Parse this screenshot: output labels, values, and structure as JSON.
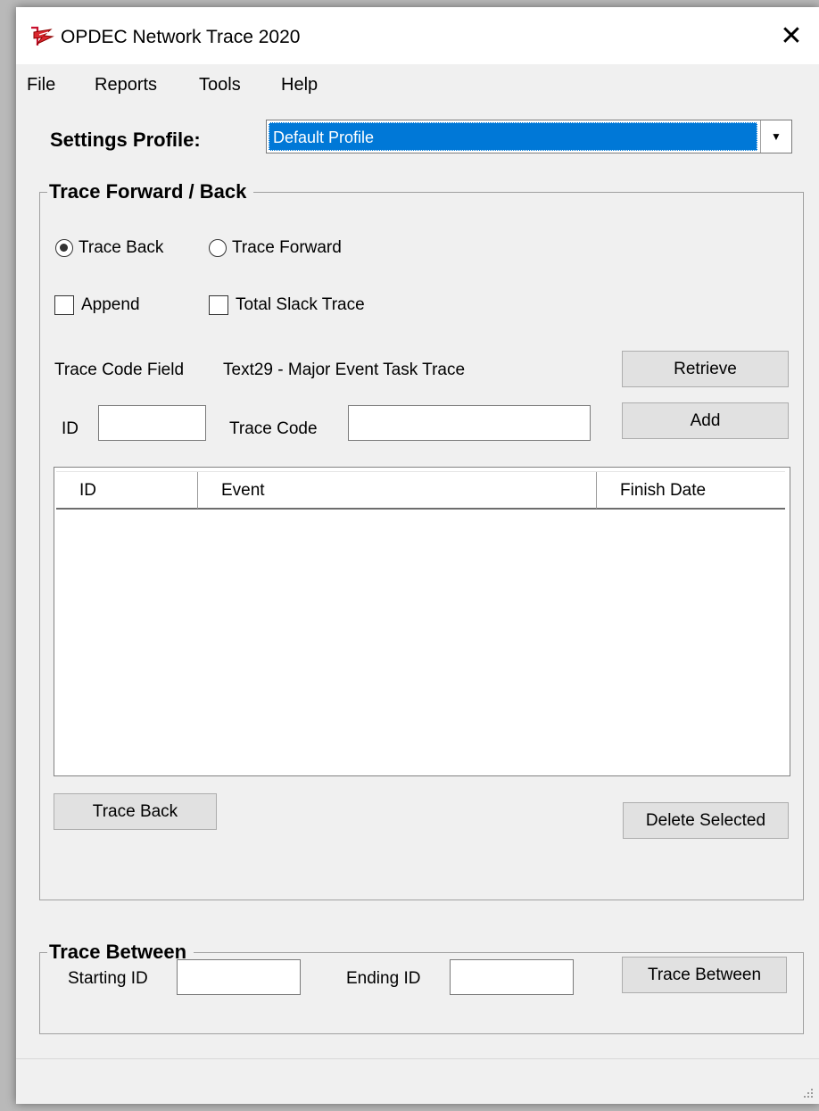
{
  "window": {
    "title": "OPDEC Network Trace 2020"
  },
  "menu": [
    {
      "label": "File"
    },
    {
      "label": "Reports"
    },
    {
      "label": "Tools"
    },
    {
      "label": "Help"
    }
  ],
  "settings": {
    "label": "Settings Profile:",
    "selected": "Default Profile"
  },
  "trace_group": {
    "legend": "Trace Forward / Back",
    "radio_back": "Trace Back",
    "radio_forward": "Trace Forward",
    "selected_radio": "Trace Back",
    "append_label": "Append",
    "append_checked": false,
    "total_slack_label": "Total Slack Trace",
    "total_slack_checked": false,
    "trace_code_field_label": "Trace Code Field",
    "trace_code_field_value": "Text29 - Major Event Task Trace",
    "retrieve_label": "Retrieve",
    "id_label": "ID",
    "id_value": "",
    "trace_code_label": "Trace Code",
    "trace_code_value": "",
    "add_label": "Add",
    "columns": [
      "ID",
      "Event",
      "Finish Date"
    ],
    "rows": [],
    "trace_back_button": "Trace Back",
    "delete_selected_button": "Delete Selected"
  },
  "between_group": {
    "legend": "Trace Between",
    "starting_id_label": "Starting ID",
    "starting_id_value": "",
    "ending_id_label": "Ending ID",
    "ending_id_value": "",
    "trace_between_button": "Trace Between"
  },
  "colors": {
    "selection": "#0078d7",
    "window_bg": "#f0f0f0",
    "button_bg": "#e1e1e1"
  },
  "icons": [
    "app-logo-icon",
    "close-icon",
    "dropdown-arrow-icon",
    "resize-grip-icon"
  ]
}
